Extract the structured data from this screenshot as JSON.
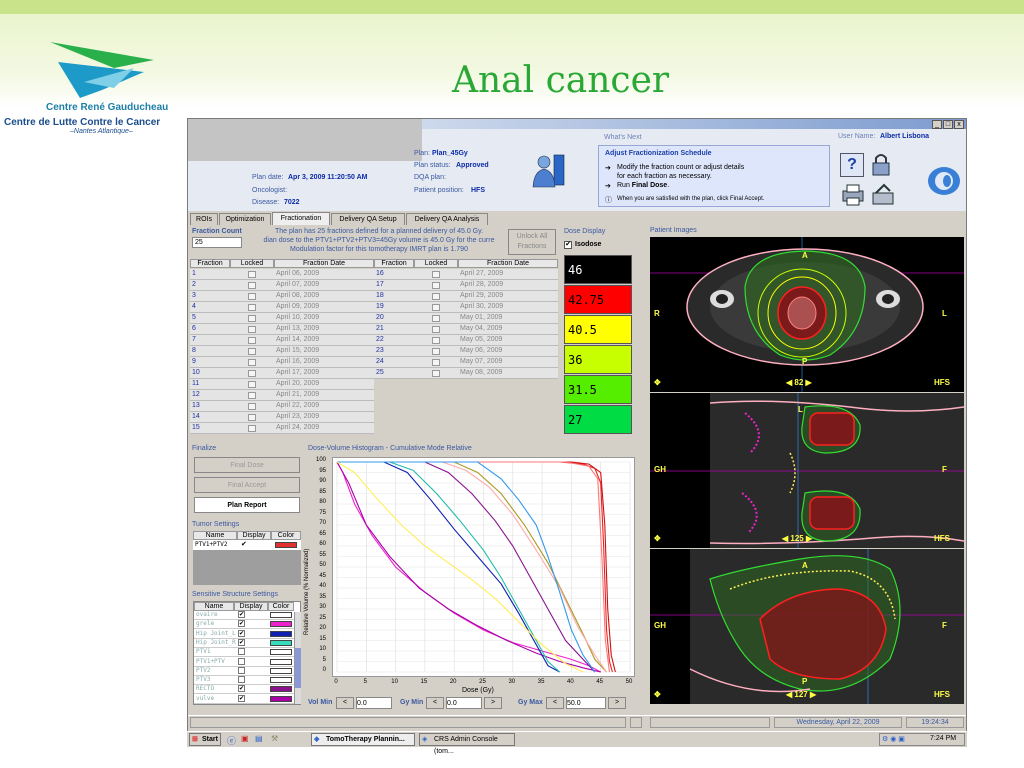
{
  "slide": {
    "title": "Anal cancer",
    "logo_line1": "Centre René Gauducheau",
    "logo_line2": "Centre de Lutte Contre le Cancer",
    "logo_line3": "–Nantes Atlantique–"
  },
  "header": {
    "plan_label": "Plan:",
    "plan_value": "Plan_45Gy",
    "plan_status_label": "Plan status:",
    "plan_status_value": "Approved",
    "plan_date_label": "Plan date:",
    "plan_date_value": "Apr 3, 2009 11:20:50 AM",
    "oncologist_label": "Oncologist:",
    "oncologist_value": "",
    "disease_label": "Disease:",
    "disease_value": "7022",
    "dqa_label": "DQA plan:",
    "dqa_value": "",
    "patient_position_label": "Patient position:",
    "patient_position_value": "HFS",
    "whats_next_label": "What's Next",
    "user_name_label": "User Name:",
    "user_name_value": "Albert Lisbona",
    "whats_next": {
      "title": "Adjust Fractionization Schedule",
      "line1": "Modify the fraction count or adjust details",
      "line2": "for each fraction as necessary.",
      "line3_prefix": "Run ",
      "line3_bold": "Final Dose",
      "line3_suffix": ".",
      "line4": "When you are satisfied with the plan, click Final Accept."
    },
    "window_buttons": [
      "_",
      "□",
      "x"
    ]
  },
  "tabs": [
    "ROIs",
    "Optimization",
    "Fractionation",
    "Delivery QA Setup",
    "Delivery QA Analysis"
  ],
  "active_tab": "Fractionation",
  "fraction": {
    "count_label": "Fraction Count",
    "count_value": "25",
    "info_line1": "The plan has 25 fractions defined for a planned delivery of 45.0 Gy.",
    "info_line2": "dian dose to the PTV1+PTV2+PTV3=45Gy volume is 45.0 Gy for the curre",
    "info_line3": "Modulation factor for this tomotherapy IMRT plan is 1.790",
    "unlock_label": "Unlock All Fractions",
    "columns": [
      "Fraction",
      "Locked",
      "Fraction Date"
    ],
    "left_rows": [
      {
        "n": "1",
        "date": "April 06, 2009"
      },
      {
        "n": "2",
        "date": "April 07, 2009"
      },
      {
        "n": "3",
        "date": "April 08, 2009"
      },
      {
        "n": "4",
        "date": "April 09, 2009"
      },
      {
        "n": "5",
        "date": "April 10, 2009"
      },
      {
        "n": "6",
        "date": "April 13, 2009"
      },
      {
        "n": "7",
        "date": "April 14, 2009"
      },
      {
        "n": "8",
        "date": "April 15, 2009"
      },
      {
        "n": "9",
        "date": "April 16, 2009"
      },
      {
        "n": "10",
        "date": "April 17, 2009"
      },
      {
        "n": "11",
        "date": "April 20, 2009"
      },
      {
        "n": "12",
        "date": "April 21, 2009"
      },
      {
        "n": "13",
        "date": "April 22, 2009"
      },
      {
        "n": "14",
        "date": "April 23, 2009"
      },
      {
        "n": "15",
        "date": "April 24, 2009"
      }
    ],
    "right_rows": [
      {
        "n": "16",
        "date": "April 27, 2009"
      },
      {
        "n": "17",
        "date": "April 28, 2009"
      },
      {
        "n": "18",
        "date": "April 29, 2009"
      },
      {
        "n": "19",
        "date": "April 30, 2009"
      },
      {
        "n": "20",
        "date": "May 01, 2009"
      },
      {
        "n": "21",
        "date": "May 04, 2009"
      },
      {
        "n": "22",
        "date": "May 05, 2009"
      },
      {
        "n": "23",
        "date": "May 06, 2009"
      },
      {
        "n": "24",
        "date": "May 07, 2009"
      },
      {
        "n": "25",
        "date": "May 08, 2009"
      }
    ]
  },
  "dose_display": {
    "title": "Dose Display",
    "isodose_label": "Isodose",
    "isodose_checked": true,
    "levels": [
      {
        "value": "46",
        "color": "#000000",
        "text_color": "#ffffff"
      },
      {
        "value": "42.75",
        "color": "#ff0000",
        "text_color": "#000000"
      },
      {
        "value": "40.5",
        "color": "#ffff00",
        "text_color": "#000000"
      },
      {
        "value": "36",
        "color": "#c8ff00",
        "text_color": "#000000"
      },
      {
        "value": "31.5",
        "color": "#55ee00",
        "text_color": "#000000"
      },
      {
        "value": "27",
        "color": "#00dd44",
        "text_color": "#000000"
      }
    ]
  },
  "finalize": {
    "title": "Finalize",
    "final_dose": "Final Dose",
    "final_accept": "Final Accept",
    "plan_report": "Plan Report"
  },
  "tumor_settings": {
    "title": "Tumor Settings",
    "columns": [
      "Name",
      "Display",
      "Color"
    ],
    "rows": [
      {
        "name": "PTV1+PTV2",
        "color": "#e03030"
      }
    ]
  },
  "sensitive_settings": {
    "title": "Sensitive Structure Settings",
    "columns": [
      "Name",
      "Display",
      "Color"
    ],
    "rows": [
      {
        "name": "ovaire",
        "checked": true,
        "color": "#ffffff"
      },
      {
        "name": "grele",
        "checked": true,
        "color": "#ee22cc"
      },
      {
        "name": "Hip Joint_L",
        "checked": true,
        "color": "#1020b0"
      },
      {
        "name": "Hip Joint_R",
        "checked": true,
        "color": "#33ddbb"
      },
      {
        "name": "PTV1",
        "checked": false,
        "color": "#ffffff"
      },
      {
        "name": "PTV1+PTV",
        "checked": false,
        "color": "#ffffff"
      },
      {
        "name": "PTV2",
        "checked": false,
        "color": "#ffffff"
      },
      {
        "name": "PTV3",
        "checked": false,
        "color": "#ffffff"
      },
      {
        "name": "RECTO",
        "checked": true,
        "color": "#8a1090"
      },
      {
        "name": "vulve",
        "checked": true,
        "color": "#aa00aa"
      }
    ]
  },
  "dvh": {
    "title": "Dose-Volume Histogram - Cumulative Mode Relative",
    "vol_min_label": "Vol Min",
    "vol_min_value": "0.0",
    "gy_min_label": "Gy Min",
    "gy_min_value": "0.0",
    "gy_max_label": "Gy Max",
    "gy_max_value": "50.0",
    "prev": "<",
    "next": ">"
  },
  "chart_data": {
    "type": "line",
    "title": "Dose-Volume Histogram - Cumulative Mode Relative",
    "xlabel": "Dose (Gy)",
    "ylabel": "Relative Volume (% Normalized)",
    "xlim": [
      0,
      50
    ],
    "ylim": [
      0,
      100
    ],
    "xticks": [
      "0",
      "5",
      "10",
      "15",
      "20",
      "25",
      "30",
      "35",
      "40",
      "45",
      "50"
    ],
    "yticks": [
      "0",
      "5",
      "10",
      "15",
      "20",
      "25",
      "30",
      "35",
      "40",
      "45",
      "50",
      "55",
      "60",
      "65",
      "70",
      "75",
      "80",
      "85",
      "90",
      "95",
      "100"
    ],
    "grid": true,
    "series": [
      {
        "color": "#ee2222",
        "points": [
          [
            0,
            100
          ],
          [
            38,
            100
          ],
          [
            42,
            99
          ],
          [
            44,
            97
          ],
          [
            45,
            90
          ],
          [
            45.5,
            60
          ],
          [
            46,
            20
          ],
          [
            46.5,
            5
          ],
          [
            47,
            0
          ]
        ]
      },
      {
        "color": "#cc1111",
        "points": [
          [
            0,
            100
          ],
          [
            40,
            100
          ],
          [
            43,
            99
          ],
          [
            45,
            95
          ],
          [
            45.7,
            70
          ],
          [
            46.2,
            30
          ],
          [
            46.8,
            8
          ],
          [
            47.5,
            0
          ]
        ]
      },
      {
        "color": "#ff7777",
        "points": [
          [
            0,
            100
          ],
          [
            39,
            100
          ],
          [
            43,
            98
          ],
          [
            44.5,
            92
          ],
          [
            45.2,
            55
          ],
          [
            45.8,
            15
          ],
          [
            46.5,
            0
          ]
        ]
      },
      {
        "color": "#ee22cc",
        "points": [
          [
            0,
            100
          ],
          [
            1,
            95
          ],
          [
            3,
            80
          ],
          [
            6,
            65
          ],
          [
            10,
            50
          ],
          [
            15,
            38
          ],
          [
            20,
            28
          ],
          [
            25,
            20
          ],
          [
            30,
            14
          ],
          [
            35,
            10
          ],
          [
            40,
            6
          ],
          [
            43,
            3
          ],
          [
            45,
            0
          ]
        ]
      },
      {
        "color": "#aa00aa",
        "points": [
          [
            0,
            100
          ],
          [
            2,
            90
          ],
          [
            5,
            70
          ],
          [
            9,
            55
          ],
          [
            14,
            40
          ],
          [
            19,
            30
          ],
          [
            24,
            22
          ],
          [
            29,
            15
          ],
          [
            34,
            9
          ],
          [
            38,
            5
          ],
          [
            42,
            2
          ],
          [
            45,
            0
          ]
        ]
      },
      {
        "color": "#1020b0",
        "points": [
          [
            0,
            100
          ],
          [
            8,
            100
          ],
          [
            12,
            95
          ],
          [
            16,
            82
          ],
          [
            20,
            68
          ],
          [
            24,
            55
          ],
          [
            28,
            42
          ],
          [
            31,
            28
          ],
          [
            33,
            18
          ],
          [
            35,
            8
          ],
          [
            36,
            3
          ],
          [
            38,
            0
          ]
        ]
      },
      {
        "color": "#22bbaa",
        "points": [
          [
            0,
            100
          ],
          [
            9,
            100
          ],
          [
            13,
            96
          ],
          [
            17,
            85
          ],
          [
            21,
            72
          ],
          [
            25,
            58
          ],
          [
            28,
            45
          ],
          [
            31,
            30
          ],
          [
            34,
            15
          ],
          [
            36,
            5
          ],
          [
            38,
            0
          ]
        ]
      },
      {
        "color": "#8a1090",
        "points": [
          [
            0,
            100
          ],
          [
            15,
            100
          ],
          [
            19,
            95
          ],
          [
            23,
            85
          ],
          [
            27,
            72
          ],
          [
            30,
            60
          ],
          [
            33,
            45
          ],
          [
            36,
            30
          ],
          [
            39,
            15
          ],
          [
            42,
            6
          ],
          [
            44,
            0
          ]
        ]
      },
      {
        "color": "#aa9922",
        "points": [
          [
            0,
            100
          ],
          [
            20,
            100
          ],
          [
            24,
            95
          ],
          [
            28,
            85
          ],
          [
            32,
            70
          ],
          [
            36,
            52
          ],
          [
            39,
            35
          ],
          [
            42,
            18
          ],
          [
            44,
            6
          ],
          [
            46,
            0
          ]
        ]
      },
      {
        "color": "#ffaaaa",
        "points": [
          [
            0,
            100
          ],
          [
            18,
            100
          ],
          [
            22,
            96
          ],
          [
            26,
            88
          ],
          [
            30,
            75
          ],
          [
            34,
            58
          ],
          [
            38,
            40
          ],
          [
            41,
            22
          ],
          [
            44,
            8
          ],
          [
            46,
            0
          ]
        ]
      },
      {
        "color": "#3399ee",
        "points": [
          [
            0,
            100
          ],
          [
            24,
            100
          ],
          [
            28,
            92
          ],
          [
            31,
            82
          ],
          [
            34,
            70
          ],
          [
            36,
            55
          ],
          [
            38,
            38
          ],
          [
            40,
            20
          ],
          [
            42,
            8
          ],
          [
            44,
            0
          ]
        ]
      },
      {
        "color": "#ffee55",
        "points": [
          [
            0,
            100
          ],
          [
            3,
            95
          ],
          [
            7,
            82
          ],
          [
            11,
            70
          ],
          [
            15,
            60
          ],
          [
            19,
            52
          ],
          [
            23,
            44
          ],
          [
            27,
            35
          ],
          [
            31,
            24
          ],
          [
            35,
            13
          ],
          [
            39,
            4
          ],
          [
            42,
            0
          ]
        ]
      }
    ]
  },
  "patient_images": {
    "title": "Patient Images",
    "views": [
      {
        "top_label": "A",
        "bottom_label": "P",
        "left_label": "R",
        "right_label": "L",
        "slice": "82",
        "orient": "HFS"
      },
      {
        "top_label": "L",
        "bottom_label": "",
        "left_label": "GH",
        "right_label": "F",
        "slice": "125",
        "orient": "HFS"
      },
      {
        "top_label": "A",
        "bottom_label": "P",
        "left_label": "GH",
        "right_label": "F",
        "slice": "127",
        "orient": "HFS"
      }
    ]
  },
  "status": {
    "date": "Wednesday, April 22, 2009",
    "time": "19:24:34"
  },
  "taskbar": {
    "start": "Start",
    "items": [
      "TomoTherapy Plannin...",
      "CRS Admin Console (tom..."
    ],
    "clock": "7:24 PM"
  }
}
